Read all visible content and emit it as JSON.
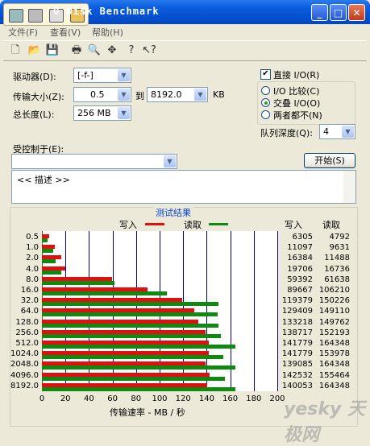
{
  "window": {
    "title": "O Disk Benchmark",
    "minimize": "_",
    "maximize": "□",
    "close": "✕"
  },
  "menu": [
    "文件(F)",
    "查看(V)",
    "帮助(H)"
  ],
  "settings": {
    "drive_label": "驱动器(D):",
    "drive_value": "[-f-]",
    "transfer_label": "传输大小(Z):",
    "transfer_from": "0.5",
    "transfer_to_label": "到",
    "transfer_to": "8192.0",
    "transfer_unit": "KB",
    "length_label": "总长度(L):",
    "length_value": "256 MB",
    "direct_io": "直接 I/O(R)",
    "io_compare": "I/O 比较(C)",
    "overlapped_io": "交叠 I/O(O)",
    "neither": "两者都不(N)",
    "queue_depth_label": "队列深度(Q):",
    "queue_depth_value": "4",
    "controlled_by_label": "受控制于(E):",
    "controlled_by_value": "",
    "start_button": "开始(S)",
    "description": "<< 描述 >>"
  },
  "results": {
    "title": "测试结果",
    "write_legend": "写入",
    "read_legend": "读取",
    "write_col": "写入",
    "read_col": "读取",
    "x_axis_label": "传输速率 - MB / 秒",
    "watermark": "yesky 天极网"
  },
  "colors": {
    "write": "#E01010",
    "read": "#0E8A0E"
  },
  "chart_data": {
    "type": "bar",
    "orientation": "horizontal",
    "categories": [
      "0.5",
      "1.0",
      "2.0",
      "4.0",
      "8.0",
      "16.0",
      "32.0",
      "64.0",
      "128.0",
      "256.0",
      "512.0",
      "1024.0",
      "2048.0",
      "4096.0",
      "8192.0"
    ],
    "series": [
      {
        "name": "写入",
        "values": [
          6.3,
          11.1,
          16.4,
          19.7,
          59.4,
          89.7,
          119.4,
          129.4,
          133.2,
          138.7,
          141.8,
          141.8,
          139.1,
          142.5,
          140.1
        ]
      },
      {
        "name": "读取",
        "values": [
          4.8,
          9.6,
          11.5,
          16.7,
          61.6,
          106.2,
          150.2,
          149.1,
          149.8,
          152.2,
          164.3,
          154.0,
          164.3,
          155.5,
          164.3
        ]
      }
    ],
    "write_numbers": [
      "6305",
      "11097",
      "16384",
      "19706",
      "59392",
      "89667",
      "119379",
      "129409",
      "133218",
      "138717",
      "141779",
      "141779",
      "139085",
      "142532",
      "140053"
    ],
    "read_numbers": [
      "4792",
      "9631",
      "11488",
      "16736",
      "61638",
      "106210",
      "150226",
      "149110",
      "149762",
      "152193",
      "164348",
      "153978",
      "164348",
      "155464",
      "164348"
    ],
    "xlabel": "传输速率 - MB / 秒",
    "xlim": [
      0,
      200
    ],
    "xticks": [
      "0",
      "20",
      "40",
      "60",
      "80",
      "100",
      "120",
      "140",
      "160",
      "180",
      "200"
    ]
  }
}
